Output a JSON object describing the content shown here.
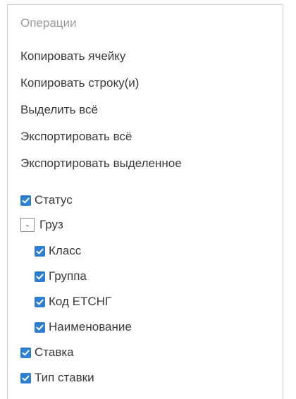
{
  "menu": {
    "section_title": "Операции",
    "items": [
      {
        "label": "Копировать ячейку"
      },
      {
        "label": "Копировать строку(и)"
      },
      {
        "label": "Выделить всё"
      },
      {
        "label": "Экспортировать всё"
      },
      {
        "label": "Экспортировать выделенное"
      }
    ]
  },
  "columns": {
    "status": {
      "label": "Статус",
      "checked": true
    },
    "cargo": {
      "label": "Груз",
      "expanded": true,
      "collapse_symbol": "-"
    },
    "cargo_children": [
      {
        "label": "Класс",
        "checked": true
      },
      {
        "label": "Группа",
        "checked": true
      },
      {
        "label": "Код ЕТСНГ",
        "checked": true
      },
      {
        "label": "Наименование",
        "checked": true
      }
    ],
    "rate": {
      "label": "Ставка",
      "checked": true
    },
    "rate_type": {
      "label": "Тип ставки",
      "checked": true
    }
  },
  "colors": {
    "checkbox": "#2f7fd0",
    "section_title": "#9a9a9a",
    "text": "#3a3a3a",
    "border": "#cfcfcf"
  }
}
